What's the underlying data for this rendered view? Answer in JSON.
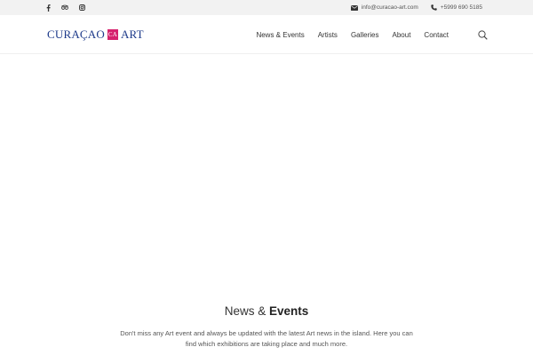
{
  "topbar": {
    "social": [
      "facebook-icon",
      "tripadvisor-icon",
      "instagram-icon"
    ],
    "email": "info@curacao-art.com",
    "phone": "+5999 690 5185"
  },
  "header": {
    "logo_left": "CURAÇAO",
    "logo_mark": "CA",
    "logo_right": "ART",
    "menu": [
      "News & Events",
      "Artists",
      "Galleries",
      "About",
      "Contact"
    ],
    "search_icon": "search-icon"
  },
  "colors": {
    "brand_blue": "#1d3a8a",
    "brand_pink": "#d6226e",
    "topbar_bg": "#f2f2f2"
  },
  "section": {
    "title_light": "News &",
    "title_bold": "Events",
    "description": "Don't miss any Art event and always be updated with the latest Art news in the island. Here you can find which exhibitions are taking place and much more."
  }
}
